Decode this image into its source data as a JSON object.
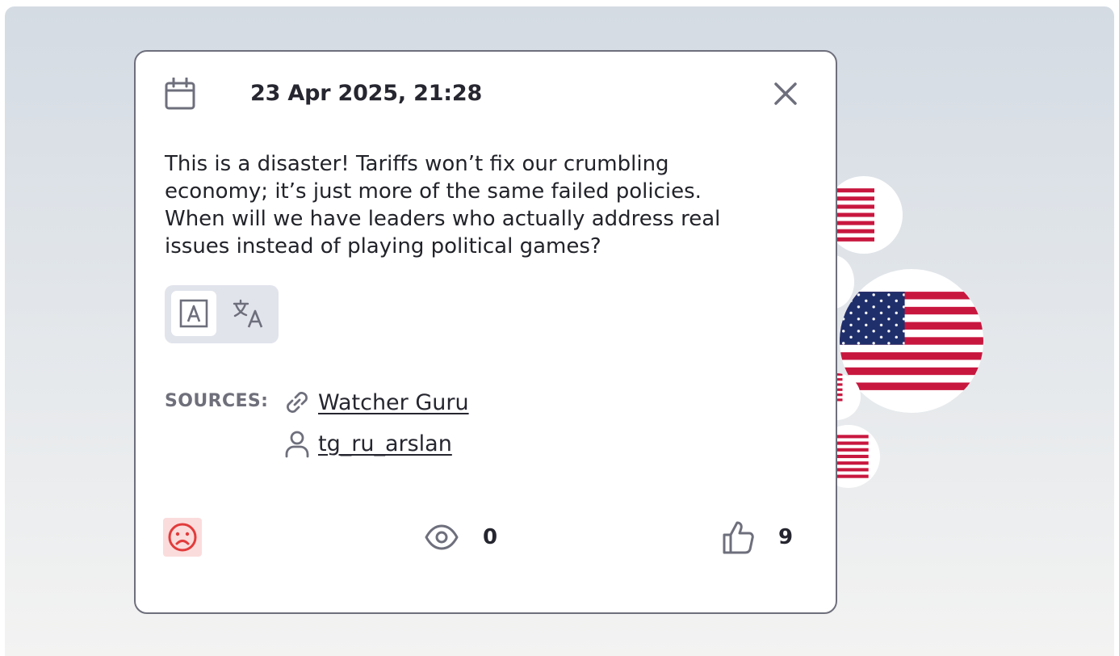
{
  "post": {
    "date": "23 Apr 2025, 21:28",
    "message": "This is a disaster! Tariffs won’t fix our crumbling economy; it’s just more of the same failed policies. When will we have leaders who actually address real issues instead of playing political games?",
    "sentiment": "negative",
    "sentiment_color": "#e23b3b"
  },
  "sources": {
    "label": "SOURCES:",
    "items": [
      {
        "icon": "link-icon",
        "text": "Watcher Guru"
      },
      {
        "icon": "user-icon",
        "text": "tg_ru_arslan"
      }
    ]
  },
  "stats": {
    "views": "0",
    "likes": "9"
  },
  "colors": {
    "flag_blue": "#1f2f6b",
    "flag_red": "#c8173f",
    "icon_gray": "#6e6f7c"
  }
}
